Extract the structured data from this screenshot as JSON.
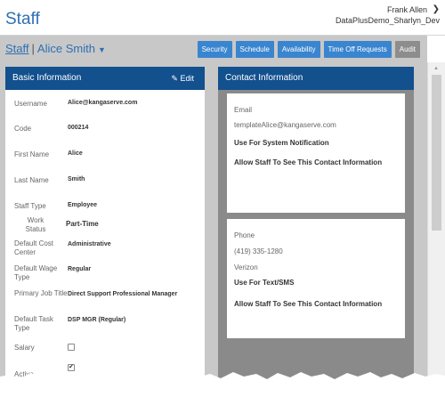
{
  "header": {
    "title": "Staff",
    "user_name": "Frank Allen",
    "user_org": "DataPlusDemo_Sharlyn_Dev"
  },
  "breadcrumb": {
    "root": "Staff",
    "separator": "|",
    "current": "Alice Smith"
  },
  "toolbar": {
    "buttons": [
      "Security",
      "Schedule",
      "Availability",
      "Time Off Requests",
      "Audit"
    ]
  },
  "basic": {
    "title": "Basic Information",
    "edit_label": "Edit",
    "fields": [
      {
        "label": "Username",
        "value": "Alice@kangaserve.com"
      },
      {
        "label": "Code",
        "value": "000214"
      },
      {
        "label": "First Name",
        "value": "Alice"
      },
      {
        "label": "Last Name",
        "value": "Smith"
      },
      {
        "label": "Staff Type",
        "value": "Employee"
      },
      {
        "label": "Work Status",
        "value": "Part-Time"
      },
      {
        "label": "Default Cost Center",
        "value": "Administrative"
      },
      {
        "label": "Default Wage Type",
        "value": "Regular"
      },
      {
        "label": "Primary Job Title",
        "value": "Direct Support Professional Manager"
      },
      {
        "label": "Default Task Type",
        "value": "DSP MGR (Regular)"
      },
      {
        "label": "Salary",
        "checked": false
      },
      {
        "label": "Active",
        "checked": true
      }
    ]
  },
  "contact": {
    "title": "Contact Information",
    "email": {
      "type": "Email",
      "address": "templateAlice@kangaserve.com",
      "note1": "Use For System Notification",
      "note2": "Allow Staff To See This Contact Information"
    },
    "phone": {
      "type": "Phone",
      "number": "(419) 335-1280",
      "carrier": "Verizon",
      "note1": "Use For Text/SMS",
      "note2": "Allow Staff To See This Contact Information"
    }
  },
  "colors": {
    "brand_blue": "#2f6fb3",
    "panel_header": "#12508e",
    "button_blue": "#3a85cf",
    "button_grey": "#8d8d8d"
  }
}
